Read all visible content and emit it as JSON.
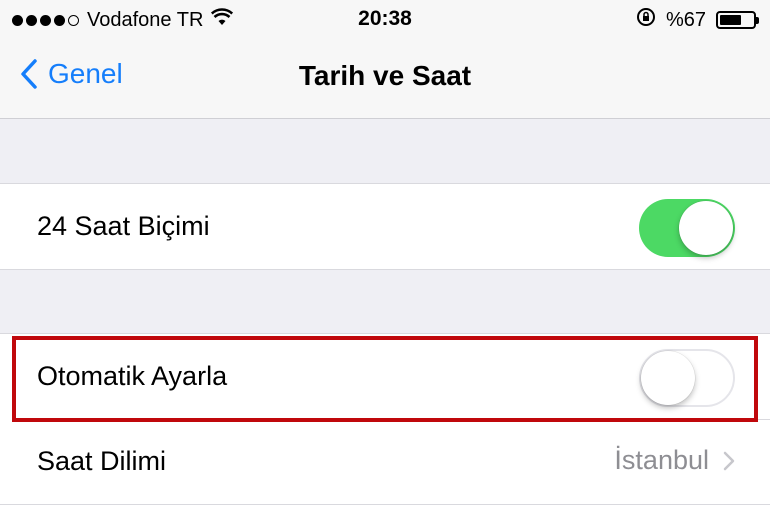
{
  "status_bar": {
    "carrier": "Vodafone TR",
    "time": "20:38",
    "battery_text": "%67",
    "battery_level": 0.67,
    "signal_bars_filled": 4,
    "signal_bars_total": 5,
    "icons": [
      "signal-icon",
      "wifi-icon",
      "rotation-lock-icon",
      "battery-icon"
    ]
  },
  "nav": {
    "back_label": "Genel",
    "title": "Tarih ve Saat"
  },
  "settings": {
    "time_format": {
      "label": "24 Saat Biçimi",
      "enabled": true
    },
    "auto_set": {
      "label": "Otomatik Ayarla",
      "enabled": false
    },
    "time_zone": {
      "label": "Saat Dilimi",
      "value": "İstanbul"
    }
  },
  "colors": {
    "accent_blue": "#157efb",
    "toggle_on": "#4cd964",
    "highlight_red": "#c0080c",
    "background": "#efeff4"
  }
}
